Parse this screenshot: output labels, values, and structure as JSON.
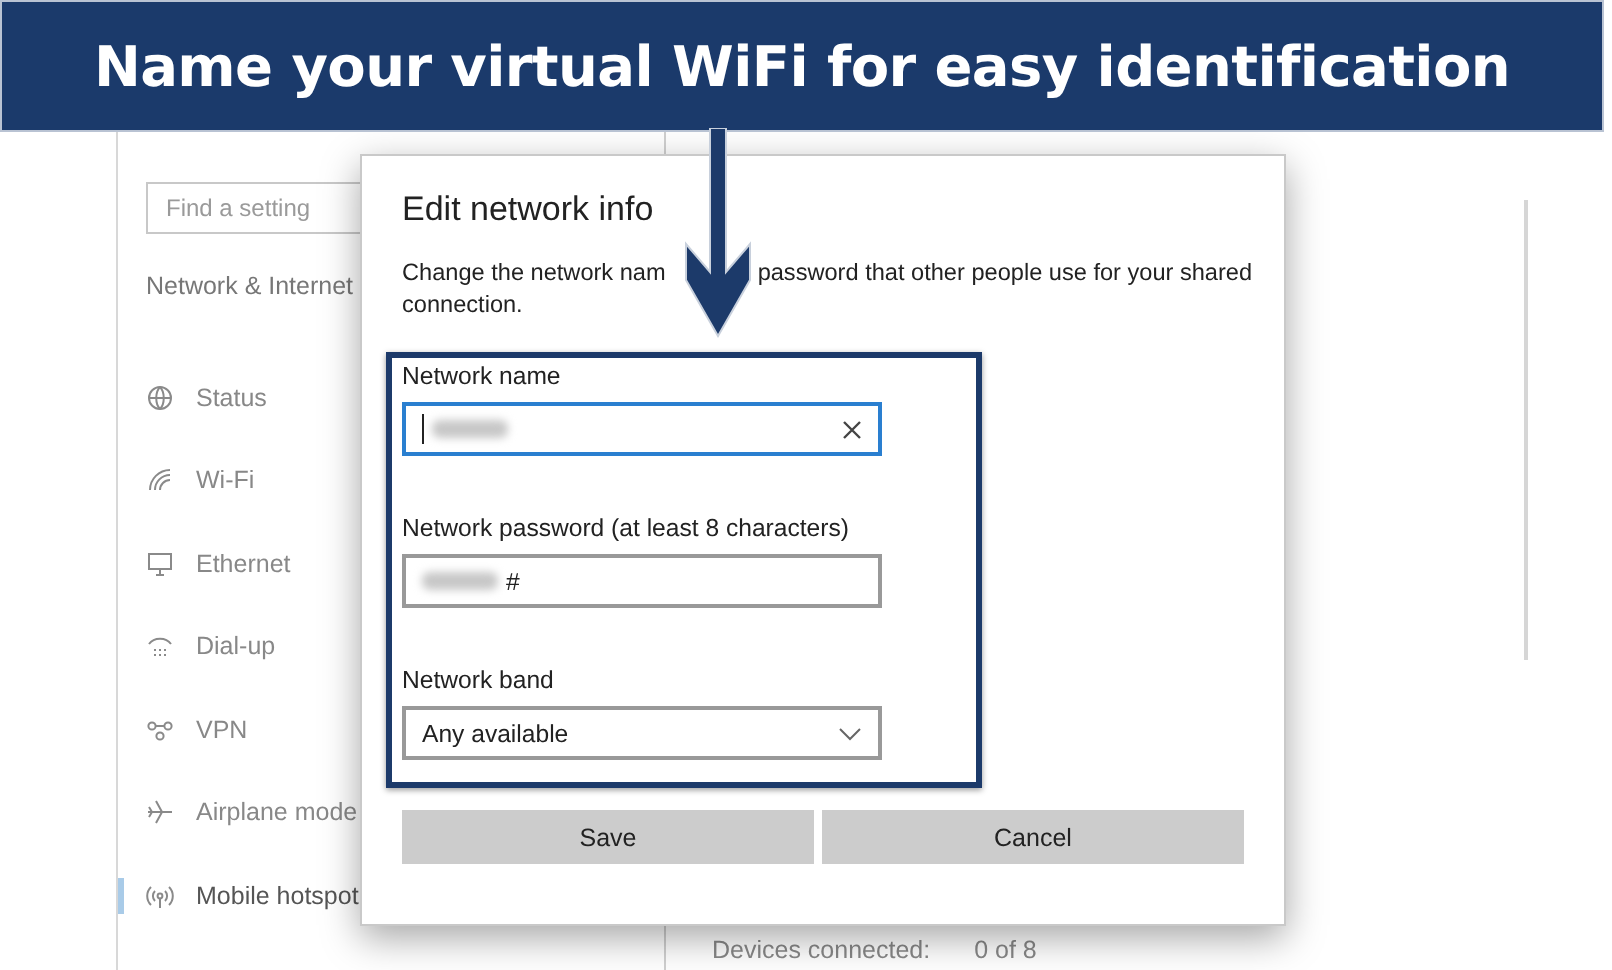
{
  "banner": {
    "text": "Name your virtual WiFi for easy identification"
  },
  "sidebar": {
    "search": {
      "placeholder": "Find a setting"
    },
    "heading": "Network & Internet",
    "items": [
      {
        "label": "Status",
        "selected": false
      },
      {
        "label": "Wi-Fi",
        "selected": false
      },
      {
        "label": "Ethernet",
        "selected": false
      },
      {
        "label": "Dial-up",
        "selected": false
      },
      {
        "label": "VPN",
        "selected": false
      },
      {
        "label": "Airplane mode",
        "selected": false
      },
      {
        "label": "Mobile hotspot",
        "selected": true
      }
    ]
  },
  "content": {
    "devices_label": "Devices connected:",
    "devices_value": "0 of 8"
  },
  "dialog": {
    "title": "Edit network info",
    "description": [
      "Change the network nam",
      "password that other people use for your shared",
      "connection."
    ],
    "fields": [
      {
        "kind": "text",
        "label": "Network name",
        "focused": true
      },
      {
        "kind": "password",
        "label": "Network password (at least 8 characters)",
        "value": "#",
        "focused": false
      },
      {
        "kind": "dropdown",
        "label": "Network band",
        "value": "Any available",
        "focused": false
      }
    ],
    "buttons": [
      "Save",
      "Cancel"
    ]
  }
}
